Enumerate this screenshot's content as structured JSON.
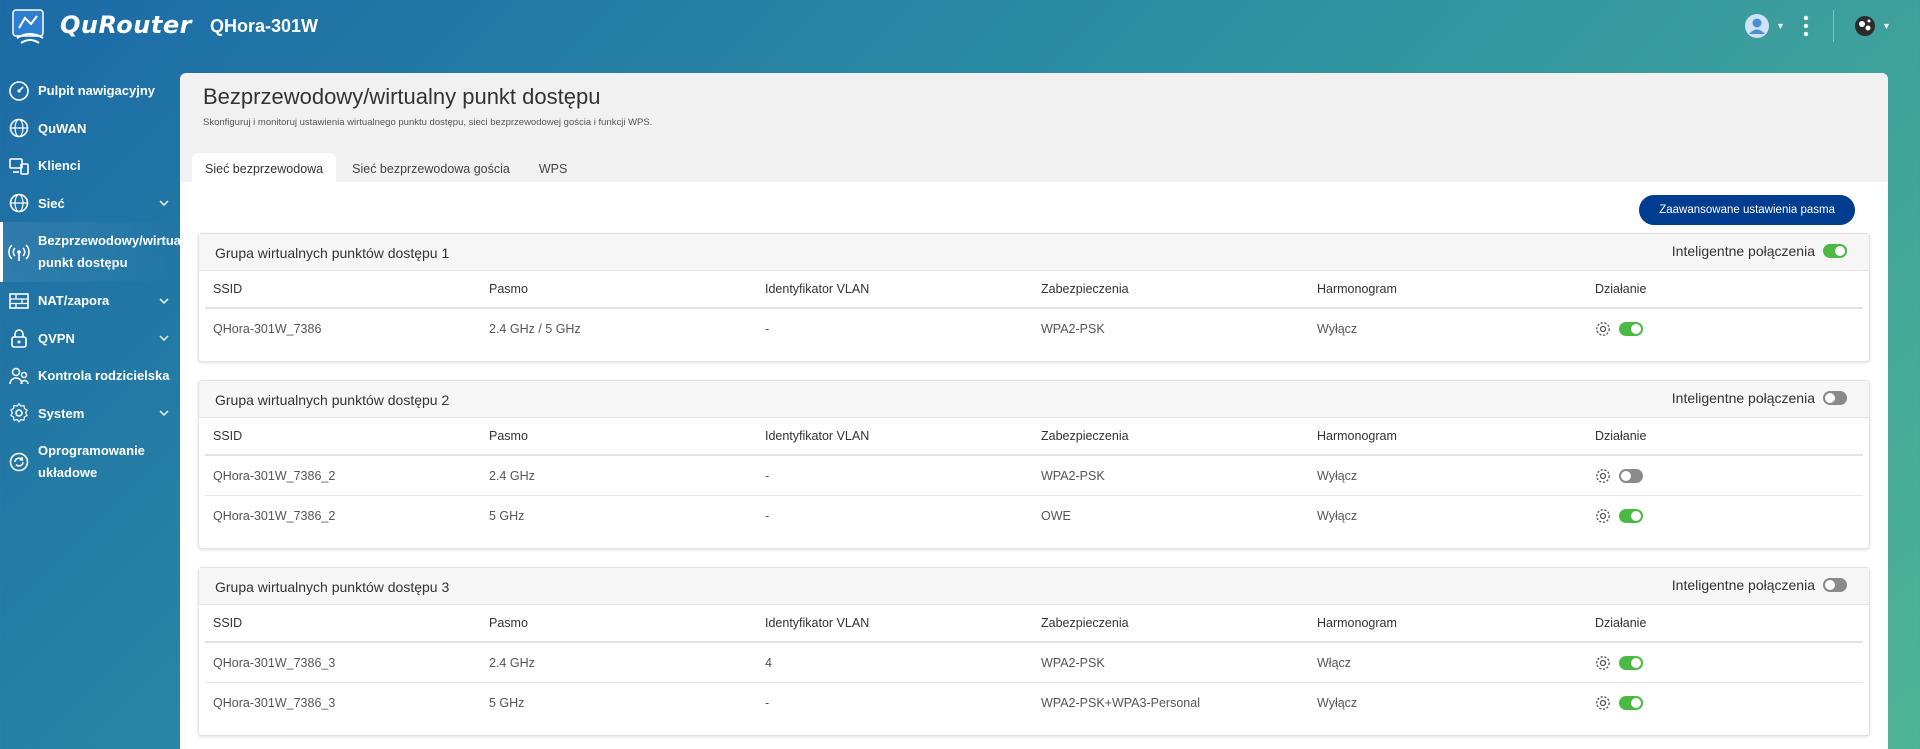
{
  "header": {
    "brand": "QuRouter",
    "model": "QHora-301W"
  },
  "sidebar": {
    "items": [
      {
        "label": "Pulpit nawigacyjny",
        "icon": "dashboard-icon",
        "expandable": false
      },
      {
        "label": "QuWAN",
        "icon": "quwan-icon",
        "expandable": false
      },
      {
        "label": "Klienci",
        "icon": "clients-icon",
        "expandable": false
      },
      {
        "label": "Sieć",
        "icon": "globe-icon",
        "expandable": true
      },
      {
        "label": "Bezprzewodowy/wirtualny punkt dostępu",
        "icon": "wireless-icon",
        "expandable": false,
        "active": true
      },
      {
        "label": "NAT/zapora",
        "icon": "firewall-icon",
        "expandable": true
      },
      {
        "label": "QVPN",
        "icon": "lock-icon",
        "expandable": true
      },
      {
        "label": "Kontrola rodzicielska",
        "icon": "parental-icon",
        "expandable": false
      },
      {
        "label": "System",
        "icon": "gear-icon",
        "expandable": true
      },
      {
        "label": "Oprogramowanie układowe",
        "icon": "firmware-icon",
        "expandable": false
      }
    ]
  },
  "page": {
    "title": "Bezprzewodowy/wirtualny punkt dostępu",
    "subtitle": "Skonfiguruj i monitoruj ustawienia wirtualnego punktu dostępu, sieci bezprzewodowej gościa i funkcji WPS.",
    "tabs": [
      {
        "label": "Sieć bezprzewodowa",
        "active": true
      },
      {
        "label": "Sieć bezprzewodowa gościa",
        "active": false
      },
      {
        "label": "WPS",
        "active": false
      }
    ],
    "advanced_button": "Zaawansowane ustawienia pasma"
  },
  "table_headers": [
    "SSID",
    "Pasmo",
    "Identyfikator VLAN",
    "Zabezpieczenia",
    "Harmonogram",
    "Działanie"
  ],
  "smart_connect_label": "Inteligentne połączenia",
  "groups": [
    {
      "title": "Grupa wirtualnych punktów dostępu 1",
      "smart_connect": true,
      "rows": [
        {
          "ssid": "QHora-301W_7386",
          "band": "2.4 GHz / 5 GHz",
          "vlan": "-",
          "security": "WPA2-PSK",
          "schedule": "Wyłącz",
          "enabled": true
        }
      ]
    },
    {
      "title": "Grupa wirtualnych punktów dostępu 2",
      "smart_connect": false,
      "rows": [
        {
          "ssid": "QHora-301W_7386_2",
          "band": "2.4 GHz",
          "vlan": "-",
          "security": "WPA2-PSK",
          "schedule": "Wyłącz",
          "enabled": false
        },
        {
          "ssid": "QHora-301W_7386_2",
          "band": "5 GHz",
          "vlan": "-",
          "security": "OWE",
          "schedule": "Wyłącz",
          "enabled": true
        }
      ]
    },
    {
      "title": "Grupa wirtualnych punktów dostępu 3",
      "smart_connect": false,
      "rows": [
        {
          "ssid": "QHora-301W_7386_3",
          "band": "2.4 GHz",
          "vlan": "4",
          "security": "WPA2-PSK",
          "schedule": "Włącz",
          "enabled": true
        },
        {
          "ssid": "QHora-301W_7386_3",
          "band": "5 GHz",
          "vlan": "-",
          "security": "WPA2-PSK+WPA3-Personal",
          "schedule": "Wyłącz",
          "enabled": true
        }
      ]
    }
  ],
  "colors": {
    "accent_button": "#003c8f",
    "toggle_on": "#4cb944",
    "toggle_off": "#8a8a8a"
  }
}
